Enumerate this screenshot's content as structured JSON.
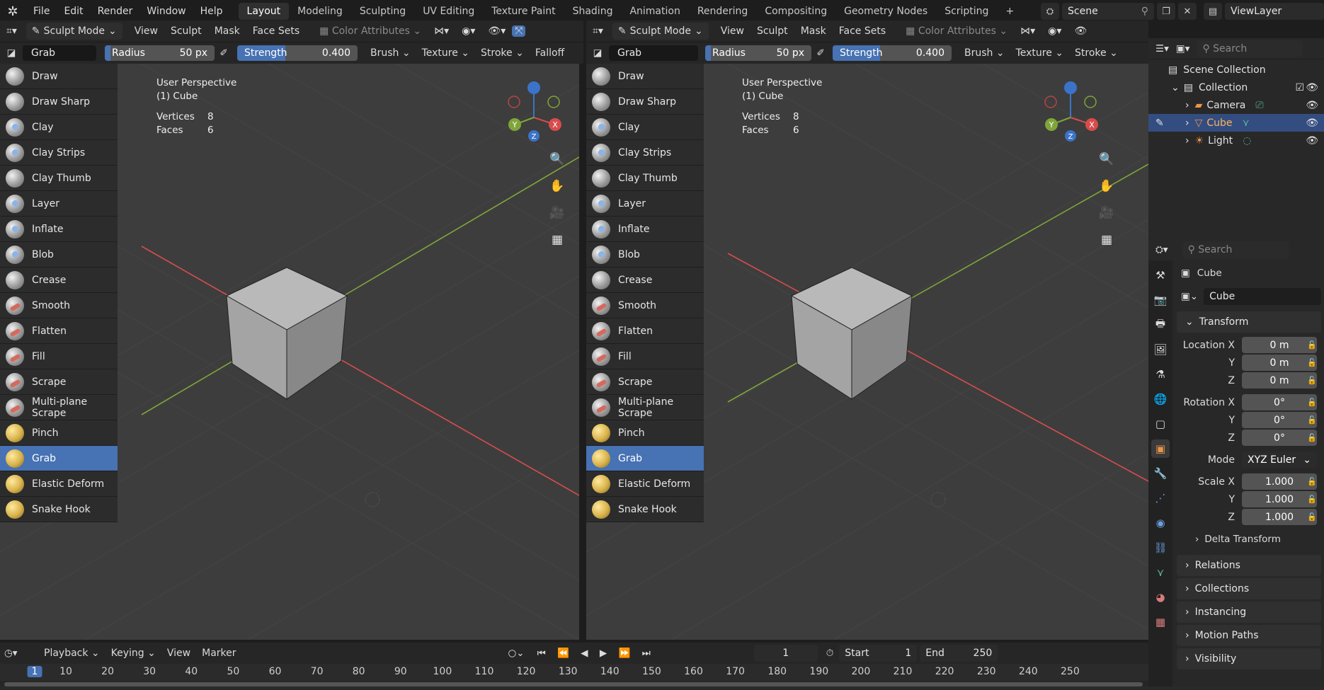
{
  "menu": [
    "File",
    "Edit",
    "Render",
    "Window",
    "Help"
  ],
  "workspaces": [
    "Layout",
    "Modeling",
    "Sculpting",
    "UV Editing",
    "Texture Paint",
    "Shading",
    "Animation",
    "Rendering",
    "Compositing",
    "Geometry Nodes",
    "Scripting"
  ],
  "active_workspace": "Layout",
  "scene": {
    "name": "Scene",
    "view_layer": "ViewLayer"
  },
  "viewport_header": {
    "mode": "Sculpt Mode",
    "menus": [
      "View",
      "Sculpt",
      "Mask",
      "Face Sets"
    ],
    "color_attributes": "Color Attributes"
  },
  "tool_settings": {
    "tool": "Grab",
    "radius_label": "Radius",
    "radius_value": "50 px",
    "strength_label": "Strength",
    "strength_value": "0.400",
    "strength_fraction": 0.4,
    "menus": [
      "Brush",
      "Texture",
      "Stroke",
      "Falloff"
    ]
  },
  "tools": [
    "Draw",
    "Draw Sharp",
    "Clay",
    "Clay Strips",
    "Clay Thumb",
    "Layer",
    "Inflate",
    "Blob",
    "Crease",
    "Smooth",
    "Flatten",
    "Fill",
    "Scrape",
    "Multi-plane Scrape",
    "Pinch",
    "Grab",
    "Elastic Deform",
    "Snake Hook"
  ],
  "selected_tool": "Grab",
  "overlay": {
    "view": "User Perspective",
    "object": "(1) Cube",
    "vertices_label": "Vertices",
    "vertices": "8",
    "faces_label": "Faces",
    "faces": "6"
  },
  "gizmo": {
    "x": "X",
    "y": "Y",
    "z": "Z"
  },
  "outliner": {
    "search_placeholder": "Search",
    "root": "Scene Collection",
    "collection": "Collection",
    "items": [
      "Camera",
      "Cube",
      "Light"
    ],
    "selected": "Cube"
  },
  "properties": {
    "search_placeholder": "Search",
    "object_name": "Cube",
    "datablock": "Cube",
    "transform_label": "Transform",
    "location": {
      "label_x": "Location X",
      "x": "0 m",
      "y": "0 m",
      "z": "0 m"
    },
    "rotation": {
      "label_x": "Rotation X",
      "x": "0°",
      "y": "0°",
      "z": "0°"
    },
    "mode_label": "Mode",
    "mode": "XYZ Euler",
    "scale": {
      "label_x": "Scale X",
      "x": "1.000",
      "y": "1.000",
      "z": "1.000"
    },
    "axis_y": "Y",
    "axis_z": "Z",
    "subpanels": [
      "Delta Transform"
    ],
    "panels": [
      "Relations",
      "Collections",
      "Instancing",
      "Motion Paths",
      "Visibility"
    ]
  },
  "timeline": {
    "menus": [
      "Playback",
      "Keying",
      "View",
      "Marker"
    ],
    "current_frame": "1",
    "start_label": "Start",
    "start": "1",
    "end_label": "End",
    "end": "250",
    "ticks": [
      "1",
      "10",
      "20",
      "30",
      "40",
      "50",
      "60",
      "70",
      "80",
      "90",
      "100",
      "110",
      "120",
      "130",
      "140",
      "150",
      "160",
      "170",
      "180",
      "190",
      "200",
      "210",
      "220",
      "230",
      "240",
      "250"
    ]
  },
  "colors": {
    "accent": "#4772b3",
    "x_axis": "#d84c4c",
    "y_axis": "#7fa53a",
    "z_axis": "#3b73c9"
  }
}
